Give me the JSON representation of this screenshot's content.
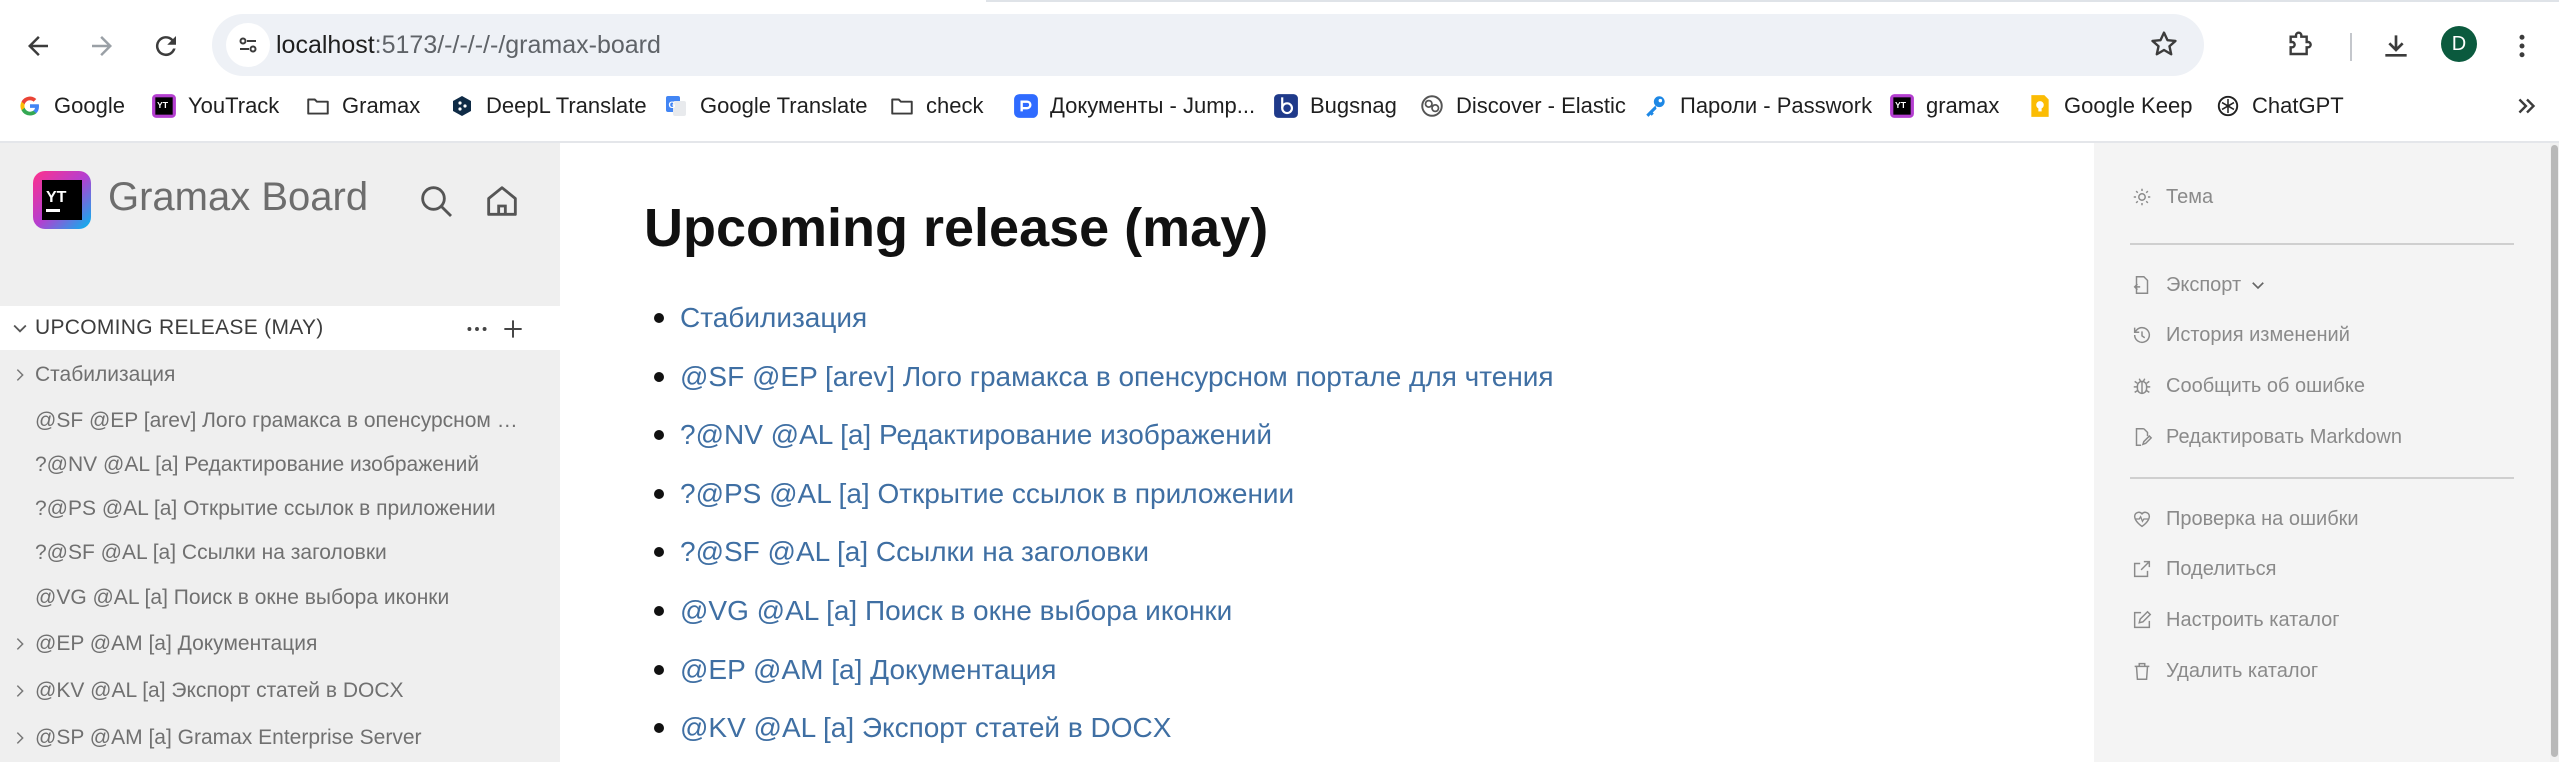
{
  "browser": {
    "url_host": "localhost",
    "url_path": ":5173/-/-/-/-/gramax-board",
    "avatar_letter": "D",
    "bookmarks": [
      {
        "label": "Google",
        "icon": "google-icon"
      },
      {
        "label": "YouTrack",
        "icon": "youtrack-icon"
      },
      {
        "label": "Gramax",
        "icon": "folder-icon"
      },
      {
        "label": "DeepL Translate",
        "icon": "deepl-icon"
      },
      {
        "label": "Google Translate",
        "icon": "google-translate-icon"
      },
      {
        "label": "check",
        "icon": "folder-icon"
      },
      {
        "label": "Документы - Jump...",
        "icon": "jump-icon"
      },
      {
        "label": "Bugsnag",
        "icon": "bugsnag-icon"
      },
      {
        "label": "Discover - Elastic",
        "icon": "elastic-icon"
      },
      {
        "label": "Пароли - Passwork",
        "icon": "key-icon"
      },
      {
        "label": "gramax",
        "icon": "youtrack-icon"
      },
      {
        "label": "Google Keep",
        "icon": "keep-icon"
      },
      {
        "label": "ChatGPT",
        "icon": "chatgpt-icon"
      }
    ]
  },
  "sidebar": {
    "app_title": "Gramax Board",
    "logo_text": "YT",
    "section_title": "UPCOMING RELEASE (MAY)",
    "items": [
      {
        "label": "Стабилизация",
        "expandable": true
      },
      {
        "label": "@SF @EP [arev] Лого грамакса в опенсурсном портале для чтения",
        "expandable": false
      },
      {
        "label": "?@NV @AL [a] Редактирование изображений",
        "expandable": false
      },
      {
        "label": "?@PS @AL [a] Открытие ссылок в приложении",
        "expandable": false
      },
      {
        "label": "?@SF @AL [a] Ссылки на заголовки",
        "expandable": false
      },
      {
        "label": "@VG @AL [a] Поиск в окне выбора иконки",
        "expandable": false
      },
      {
        "label": "@EP @AM [a] Документация",
        "expandable": true
      },
      {
        "label": "@KV @AL [a] Экспорт статей в DOCX",
        "expandable": true
      },
      {
        "label": "@SP @AM [a] Gramax Enterprise Server",
        "expandable": true
      }
    ]
  },
  "article": {
    "title": "Upcoming release (may)",
    "links": [
      "Стабилизация",
      "@SF @EP [arev] Лого грамакса в опенсурсном портале для чтения",
      "?@NV @AL [a] Редактирование изображений",
      "?@PS @AL [a] Открытие ссылок в приложении",
      "?@SF @AL [a] Ссылки на заголовки",
      "@VG @AL [a] Поиск в окне выбора иконки",
      "@EP @AM [a] Документация",
      "@KV @AL [a] Экспорт статей в DOCX"
    ]
  },
  "right_panel": {
    "theme": "Тема",
    "export": "Экспорт",
    "history": "История изменений",
    "report_bug": "Сообщить об ошибке",
    "edit_markdown": "Редактировать Markdown",
    "check_errors": "Проверка на ошибки",
    "share": "Поделиться",
    "configure_catalog": "Настроить каталог",
    "delete_catalog": "Удалить каталог"
  },
  "colors": {
    "link": "#3f6fa3",
    "sidebar_bg": "#efefef",
    "right_panel_bg": "#f4f4f4",
    "avatar_bg": "#0b5a3e"
  }
}
